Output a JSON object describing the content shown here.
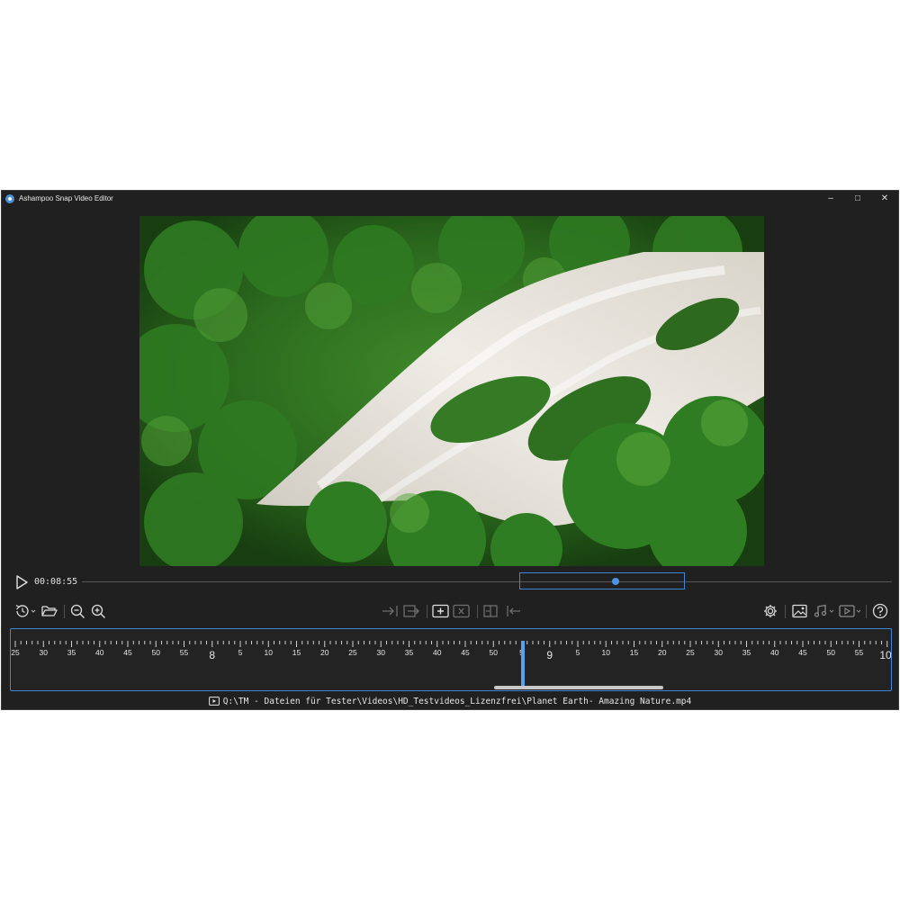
{
  "window": {
    "title": "Ashampoo Snap Video Editor",
    "controls": {
      "minimize": "–",
      "maximize": "□",
      "close": "✕"
    }
  },
  "player": {
    "time": "00:08:55",
    "play_icon": "play-icon"
  },
  "toolbar": {
    "left": [
      "history-icon",
      "chevron-down-icon",
      "open-folder-icon",
      "zoom-out-icon",
      "zoom-in-icon"
    ],
    "center": [
      "trim-start-icon",
      "trim-end-icon",
      "add-segment-icon",
      "remove-segment-icon",
      "cut-left-icon",
      "cut-right-icon"
    ],
    "right": [
      "gear-icon",
      "image-icon",
      "music-icon",
      "video-icon",
      "help-icon"
    ]
  },
  "timeline": {
    "labels": [
      "25",
      "30",
      "35",
      "40",
      "45",
      "50",
      "55",
      "8",
      "5",
      "10",
      "15",
      "20",
      "25",
      "30",
      "35",
      "40",
      "45",
      "50",
      "5",
      "9",
      "5",
      "10",
      "15",
      "20",
      "25",
      "30",
      "35",
      "40",
      "45",
      "50",
      "55",
      "10"
    ],
    "major_labels": [
      "8",
      "9",
      "10"
    ]
  },
  "status": {
    "file_path": "Q:\\TM - Dateien für Tester\\Videos\\HD_Testvideos_Lizenzfrei\\Planet Earth- Amazing Nature.mp4"
  },
  "colors": {
    "accent": "#3f86d6",
    "background": "#202020"
  }
}
